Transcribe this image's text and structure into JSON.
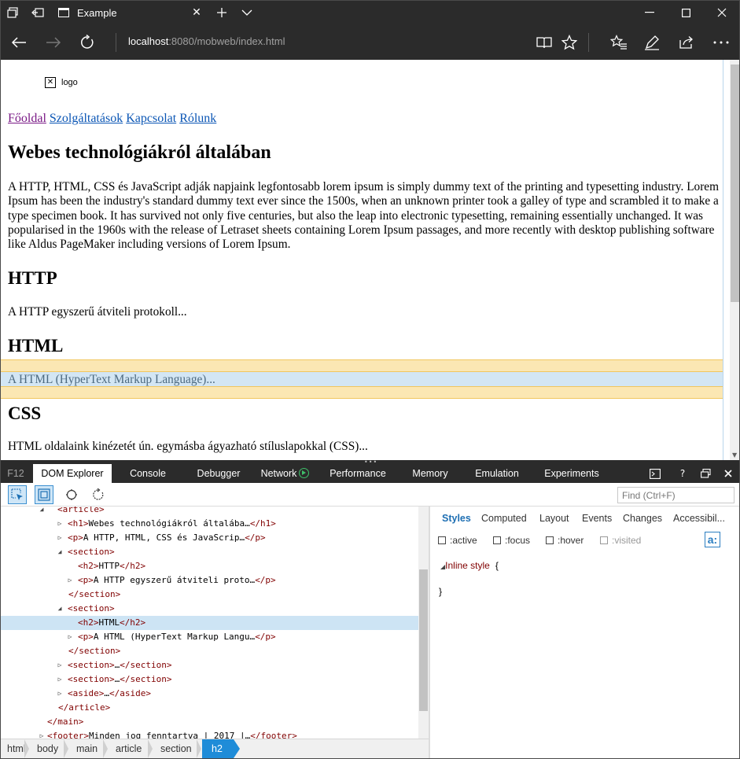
{
  "browser": {
    "tab_title": "Example",
    "url_host": "localhost",
    "url_rest": ":8080/mobweb/index.html"
  },
  "page": {
    "logo_alt": "logo",
    "nav": [
      "Főoldal",
      "Szolgáltatások",
      "Kapcsolat",
      "Rólunk"
    ],
    "h1": "Webes technológiákról általában",
    "intro": "A HTTP, HTML, CSS és JavaScript adják napjaink legfontosabb lorem ipsum is simply dummy text of the printing and typesetting industry. Lorem Ipsum has been the industry's standard dummy text ever since the 1500s, when an unknown printer took a galley of type and scrambled it to make a type specimen book. It has survived not only five centuries, but also the leap into electronic typesetting, remaining essentially unchanged. It was popularised in the 1960s with the release of Letraset sheets containing Lorem Ipsum passages, and more recently with desktop publishing software like Aldus PageMaker including versions of Lorem Ipsum.",
    "sections": [
      {
        "heading": "HTTP",
        "text": "A HTTP egyszerű átviteli protokoll..."
      },
      {
        "heading": "HTML",
        "text": "A HTML (HyperText Markup Language)..."
      },
      {
        "heading": "CSS",
        "text": "HTML oldalaink kinézetét ún. egymásba ágyazható stíluslapokkal (CSS)..."
      }
    ]
  },
  "devtools": {
    "tabs": [
      "F12",
      "DOM Explorer",
      "Console",
      "Debugger",
      "Network",
      "Performance",
      "Memory",
      "Emulation",
      "Experiments"
    ],
    "find_placeholder": "Find (Ctrl+F)",
    "dom_lines": [
      {
        "indent": 0,
        "tri": "open",
        "code": "<article>",
        "partial": true
      },
      {
        "indent": 1,
        "tri": "closed",
        "code": "<h1>Webes technológiákról általába…</h1>"
      },
      {
        "indent": 1,
        "tri": "closed",
        "code": "<p>A HTTP, HTML, CSS és JavaScrip…</p>"
      },
      {
        "indent": 1,
        "tri": "open",
        "code": "<section>"
      },
      {
        "indent": 2,
        "tri": "none",
        "code": "<h2>HTTP</h2>"
      },
      {
        "indent": 2,
        "tri": "closed",
        "code": "<p>A HTTP egyszerű átviteli proto…</p>"
      },
      {
        "indent": 2,
        "tri": "none",
        "code": "</section>",
        "shift": -1
      },
      {
        "indent": 1,
        "tri": "open",
        "code": "<section>"
      },
      {
        "indent": 2,
        "tri": "none",
        "code": "<h2>HTML</h2>",
        "selected": true
      },
      {
        "indent": 2,
        "tri": "closed",
        "code": "<p>A HTML (HyperText Markup Langu…</p>"
      },
      {
        "indent": 2,
        "tri": "none",
        "code": "</section>",
        "shift": -1
      },
      {
        "indent": 1,
        "tri": "closed",
        "code": "<section>…</section>"
      },
      {
        "indent": 1,
        "tri": "closed",
        "code": "<section>…</section>"
      },
      {
        "indent": 1,
        "tri": "closed",
        "code": "<aside>…</aside>"
      },
      {
        "indent": 1,
        "tri": "none",
        "code": "</article>",
        "shift": -1
      },
      {
        "indent": 0,
        "tri": "none",
        "code": "</main>",
        "shift": -1
      },
      {
        "indent": 0,
        "tri": "closed",
        "code": "<footer>Minden jog fenntartva | 2017 |…</footer>",
        "partial": true
      }
    ],
    "style_tabs": [
      "Styles",
      "Computed",
      "Layout",
      "Events",
      "Changes",
      "Accessibil..."
    ],
    "checkboxes": [
      ":active",
      ":focus",
      ":hover",
      ":visited"
    ],
    "inline_style_label": "Inline style",
    "open_brace": "{",
    "close_brace": "}",
    "breadcrumb": [
      "html",
      "body",
      "main",
      "article",
      "section",
      "h2"
    ]
  }
}
